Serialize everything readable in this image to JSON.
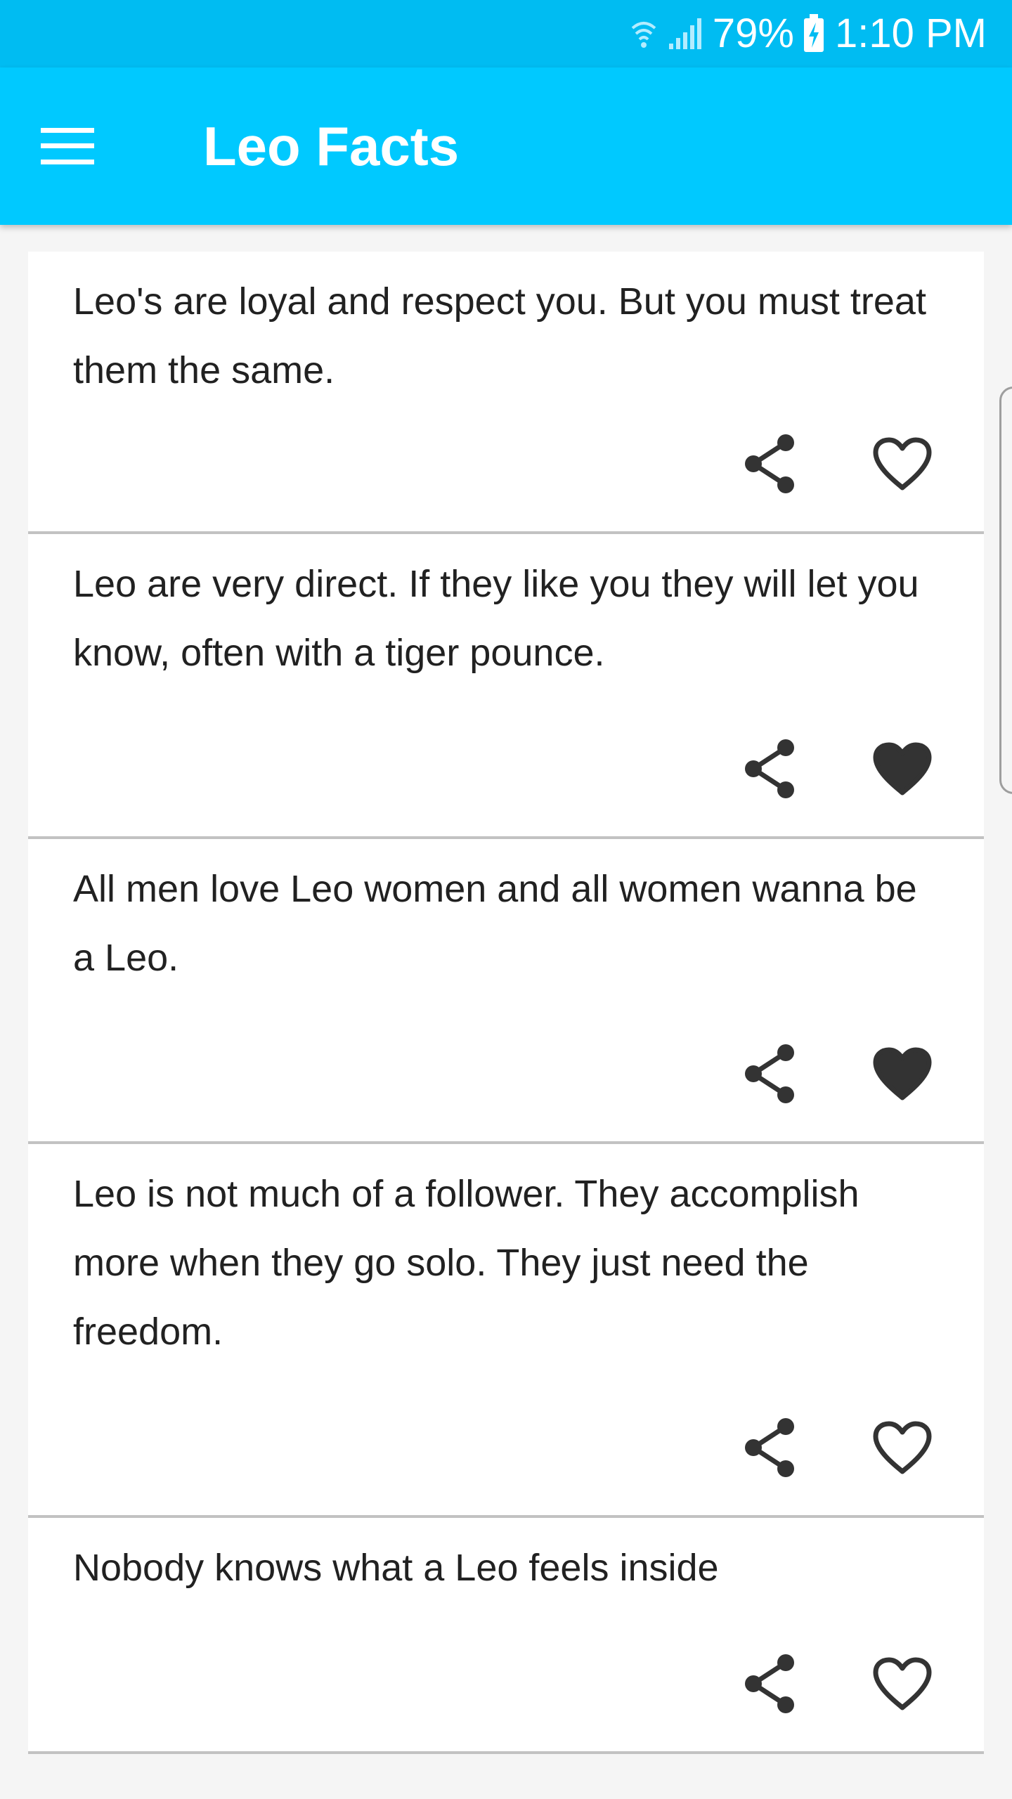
{
  "status_bar": {
    "wifi_icon": "wifi-icon",
    "signal_icon": "cell-signal-icon",
    "battery_percent": "79%",
    "battery_icon": "battery-charging-icon",
    "time": "1:10 PM"
  },
  "app_bar": {
    "menu_icon": "hamburger-menu-icon",
    "title": "Leo Facts"
  },
  "facts": [
    {
      "text": "Leo's are loyal and respect you. But you must treat them the same.",
      "liked": false
    },
    {
      "text": "Leo are very direct. If they like you they will let you know, often with a tiger pounce.",
      "liked": true
    },
    {
      "text": "All men love Leo women and all women wanna be a Leo.",
      "liked": true
    },
    {
      "text": "Leo is not much of a follower. They accomplish more when they go solo. They just need the freedom.",
      "liked": false
    },
    {
      "text": "Nobody knows what a Leo feels inside",
      "liked": false
    }
  ],
  "icons": {
    "share": "share-icon",
    "heart_outline": "heart-outline-icon",
    "heart_filled": "heart-filled-icon"
  },
  "colors": {
    "status_bar": "#00bcf2",
    "app_bar": "#00c9ff",
    "text": "#212121",
    "icon": "#333333",
    "divider": "#c2c2c2"
  }
}
